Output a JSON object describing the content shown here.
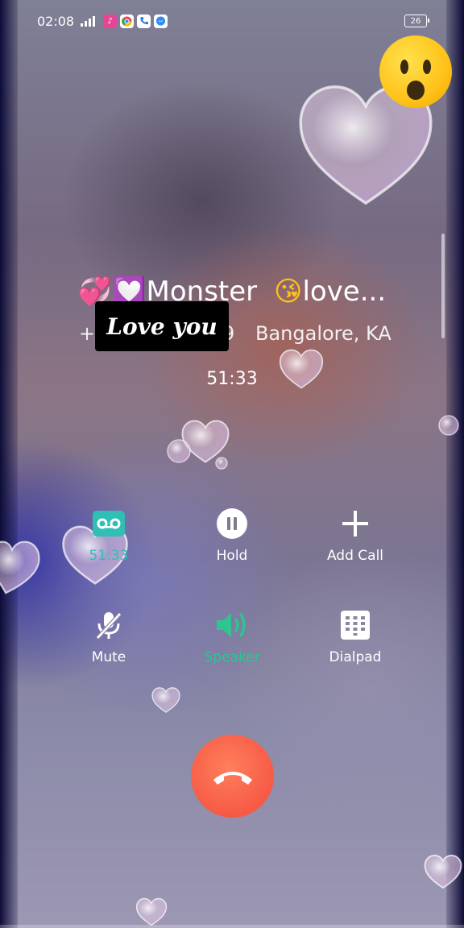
{
  "status_bar": {
    "time": "02:08",
    "battery": "26"
  },
  "caller": {
    "name": "Monster",
    "name_suffix": "love...",
    "number_prefix": "+9",
    "number_suffix": "9",
    "location": "Bangalore, KA",
    "sticker_text": "Love you",
    "duration": "51:33"
  },
  "controls": {
    "record_label": "51:33",
    "hold_label": "Hold",
    "add_call_label": "Add Call",
    "mute_label": "Mute",
    "speaker_label": "Speaker",
    "dialpad_label": "Dialpad"
  },
  "colors": {
    "accent_green": "#2ec58f",
    "end_call": "#f65a45"
  },
  "icons": {
    "record": "cassette-icon",
    "hold": "pause-icon",
    "add_call": "plus-icon",
    "mute": "mic-off-icon",
    "speaker": "speaker-icon",
    "dialpad": "dialpad-icon",
    "end_call": "phone-hangup-icon"
  }
}
